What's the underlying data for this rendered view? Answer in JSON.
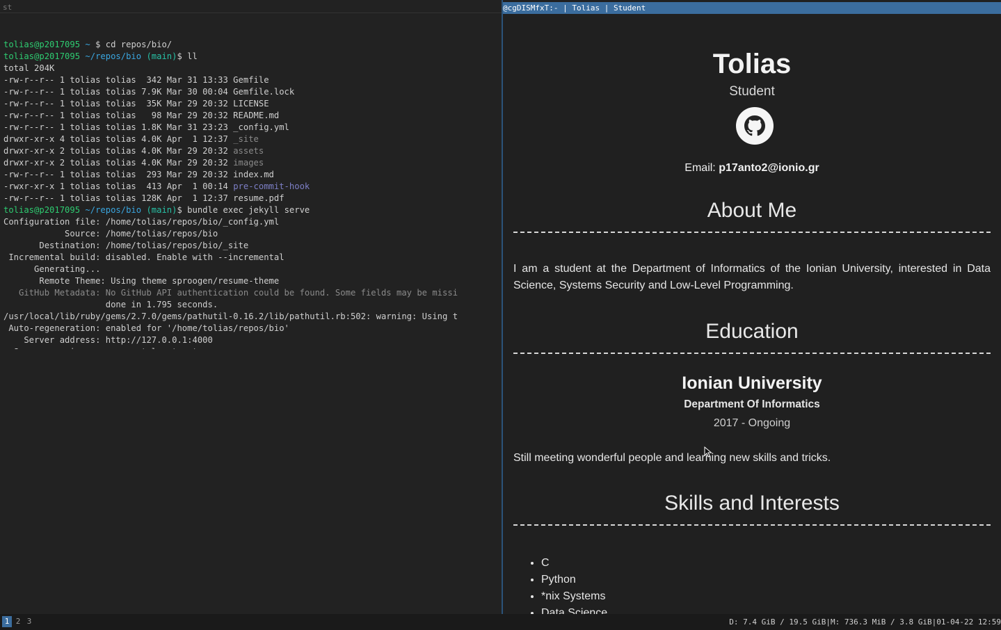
{
  "terminal": {
    "title": "st",
    "lines": [
      [
        {
          "t": "tolias@p2017095",
          "c": "user"
        },
        {
          "t": " ~ ",
          "c": "cwd"
        },
        {
          "t": "$ cd repos/bio/",
          "c": "plain"
        }
      ],
      [
        {
          "t": "tolias@p2017095",
          "c": "user"
        },
        {
          "t": " ~/repos/bio ",
          "c": "cwd"
        },
        {
          "t": "(main)",
          "c": "br"
        },
        {
          "t": "$ ll",
          "c": "plain"
        }
      ],
      [
        {
          "t": "total 204K",
          "c": "plain"
        }
      ],
      [
        {
          "t": "-rw-r--r-- 1 tolias tolias  342 Mar 31 13:33 Gemfile",
          "c": "plain"
        }
      ],
      [
        {
          "t": "-rw-r--r-- 1 tolias tolias 7.9K Mar 30 00:04 Gemfile.lock",
          "c": "plain"
        }
      ],
      [
        {
          "t": "-rw-r--r-- 1 tolias tolias  35K Mar 29 20:32 LICENSE",
          "c": "plain"
        }
      ],
      [
        {
          "t": "-rw-r--r-- 1 tolias tolias   98 Mar 29 20:32 README.md",
          "c": "plain"
        }
      ],
      [
        {
          "t": "-rw-r--r-- 1 tolias tolias 1.8K Mar 31 23:23 _config.yml",
          "c": "plain"
        }
      ],
      [
        {
          "t": "drwxr-xr-x 4 tolias tolias 4.0K Apr  1 12:37 ",
          "c": "plain"
        },
        {
          "t": "_site",
          "c": "dim"
        }
      ],
      [
        {
          "t": "drwxr-xr-x 2 tolias tolias 4.0K Mar 29 20:32 ",
          "c": "plain"
        },
        {
          "t": "assets",
          "c": "dim"
        }
      ],
      [
        {
          "t": "drwxr-xr-x 2 tolias tolias 4.0K Mar 29 20:32 ",
          "c": "plain"
        },
        {
          "t": "images",
          "c": "dim"
        }
      ],
      [
        {
          "t": "-rw-r--r-- 1 tolias tolias  293 Mar 29 20:32 index.md",
          "c": "plain"
        }
      ],
      [
        {
          "t": "-rwxr-xr-x 1 tolias tolias  413 Apr  1 00:14 ",
          "c": "plain"
        },
        {
          "t": "pre-commit-hook",
          "c": "exec"
        }
      ],
      [
        {
          "t": "-rw-r--r-- 1 tolias tolias 128K Apr  1 12:37 resume.pdf",
          "c": "plain"
        }
      ],
      [
        {
          "t": "tolias@p2017095",
          "c": "user"
        },
        {
          "t": " ~/repos/bio ",
          "c": "cwd"
        },
        {
          "t": "(main)",
          "c": "br"
        },
        {
          "t": "$ bundle exec jekyll serve",
          "c": "plain"
        }
      ],
      [
        {
          "t": "Configuration file: /home/tolias/repos/bio/_config.yml",
          "c": "plain"
        }
      ],
      [
        {
          "t": "            Source: /home/tolias/repos/bio",
          "c": "plain"
        }
      ],
      [
        {
          "t": "       Destination: /home/tolias/repos/bio/_site",
          "c": "plain"
        }
      ],
      [
        {
          "t": " Incremental build: disabled. Enable with --incremental",
          "c": "plain"
        }
      ],
      [
        {
          "t": "      Generating...",
          "c": "plain"
        }
      ],
      [
        {
          "t": "       Remote Theme: Using theme sproogen/resume-theme",
          "c": "plain"
        }
      ],
      [
        {
          "t": "   GitHub Metadata: No GitHub API authentication could be found. Some fields may be missi",
          "c": "dim"
        }
      ],
      [
        {
          "t": "                    done in 1.795 seconds.",
          "c": "plain"
        }
      ],
      [
        {
          "t": "/usr/local/lib/ruby/gems/2.7.0/gems/pathutil-0.16.2/lib/pathutil.rb:502: warning: Using t",
          "c": "plain"
        }
      ],
      [
        {
          "t": " Auto-regeneration: enabled for '/home/tolias/repos/bio'",
          "c": "plain"
        }
      ],
      [
        {
          "t": "    Server address: http://127.0.0.1:4000",
          "c": "plain"
        }
      ],
      [
        {
          "t": "  Server running... press ctrl-c to stop.",
          "c": "plain"
        }
      ]
    ]
  },
  "browser": {
    "title": "@cgDISMfxT:- | Tolias | Student",
    "name": "Tolias",
    "role": "Student",
    "email_label": "Email: ",
    "email": "p17anto2@ionio.gr",
    "about_title": "About Me",
    "about_text": "I am a student at the Department of Informatics of the Ionian University, interested in Data Science, Systems Security and Low-Level Programming.",
    "education_title": "Education",
    "university": "Ionian University",
    "department": "Department Of Informatics",
    "years": "2017 - Ongoing",
    "education_text": "Still meeting wonderful people and learning new skills and tricks.",
    "skills_title": "Skills and Interests",
    "skills": [
      "C",
      "Python",
      "*nix Systems",
      "Data Science"
    ]
  },
  "colors": {
    "accent": "#3b6d9e",
    "prompt_user": "#2ecc71",
    "prompt_cwd": "#3aa6e0"
  },
  "bar": {
    "workspaces": [
      "1",
      "2",
      "3"
    ],
    "active_workspace": "1",
    "status": "D: 7.4 GiB / 19.5 GiB|M: 736.3 MiB / 3.8 GiB|01-04-22 12:59"
  }
}
